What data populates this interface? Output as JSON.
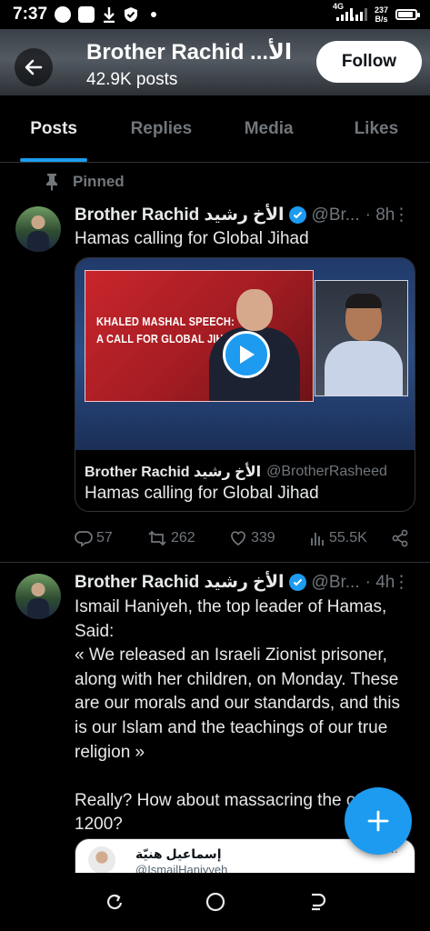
{
  "status_bar": {
    "time": "7:37",
    "network_type": "4G",
    "net_speed_value": "237",
    "net_speed_unit": "B/s",
    "battery_level": 0.9
  },
  "header": {
    "back_icon": "arrow-left-icon",
    "name": "Brother Rachid ...الأ",
    "posts": "42.9K posts",
    "follow_label": "Follow"
  },
  "tabs": [
    {
      "label": "Posts",
      "active": true
    },
    {
      "label": "Replies",
      "active": false
    },
    {
      "label": "Media",
      "active": false
    },
    {
      "label": "Likes",
      "active": false
    }
  ],
  "pinned_label": "Pinned",
  "tweet1": {
    "name": "Brother Rachid الأخ رشيد",
    "handle": "@Br...",
    "time": "· 8h",
    "text": "Hamas calling for Global Jihad",
    "media": {
      "headline": "KHALED MASHAL SPEECH: A CALL FOR GLOBAL JIHAD",
      "headline_line1": "KHALED MASHAL SPEECH:",
      "headline_line2": "A CALL FOR GLOBAL JIHAD"
    },
    "quote": {
      "name": "Brother Rachid الأخ رشيد",
      "handle": "@BrotherRasheed",
      "text": "Hamas calling for Global Jihad"
    },
    "actions": {
      "replies": "57",
      "reposts": "262",
      "likes": "339",
      "views": "55.5K"
    }
  },
  "tweet2": {
    "name": "Brother Rachid الأخ رشيد",
    "handle": "@Br...",
    "time": "· 4h",
    "text": "Ismail Haniyeh, the top leader of Hamas, Said:\n« We released an Israeli Zionist prisoner, along with her children, on Monday. These are our morals and our standards, and this is our Islam and the teachings of our true religion »\n\nReally? How about massacring the other 1200?",
    "embed": {
      "name": "إسماعيل هنيّة",
      "handle": "@IsmailHaniyyeh"
    }
  },
  "colors": {
    "accent": "#1d9bf0",
    "background": "#000000",
    "muted": "#71767b"
  }
}
